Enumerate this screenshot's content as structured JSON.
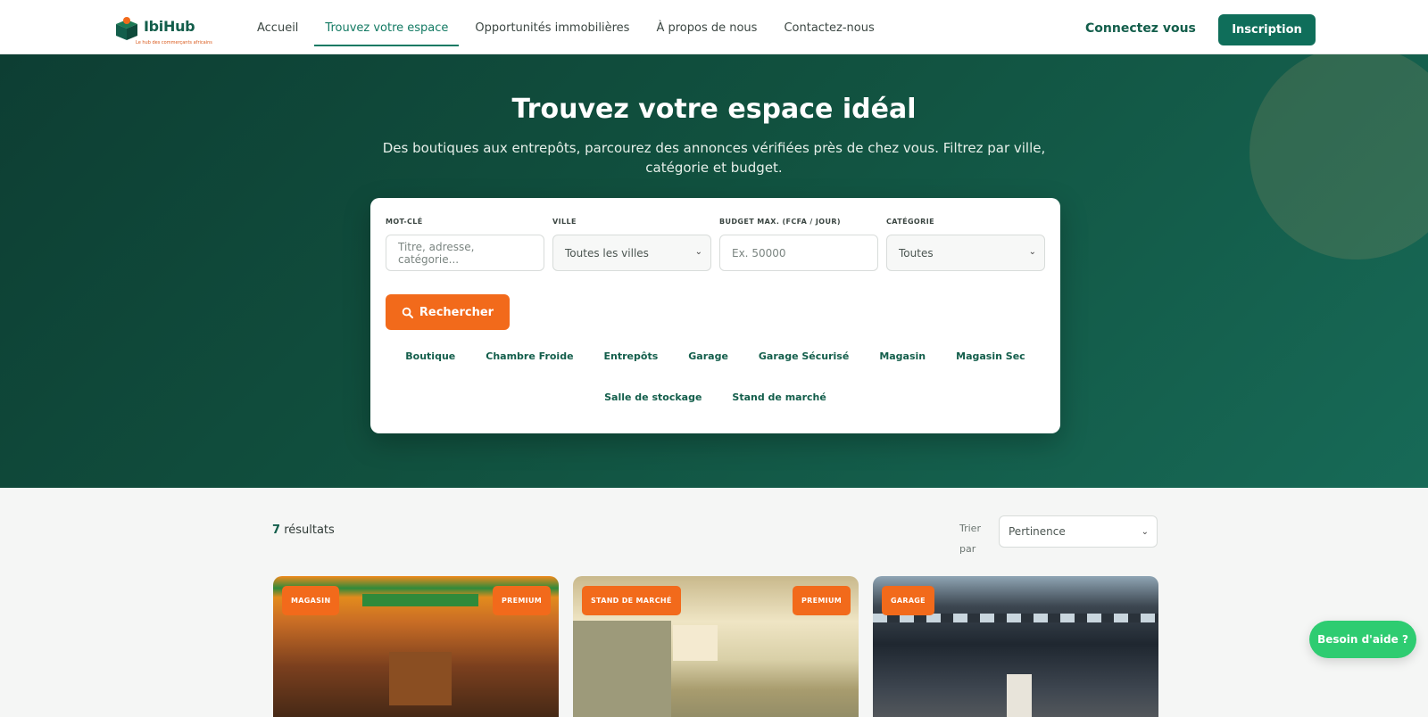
{
  "header": {
    "logo_text": "IbiHub",
    "logo_tagline": "Le hub des commerçants africains",
    "nav": [
      "Accueil",
      "Trouvez votre espace",
      "Opportunités immobilières",
      "À propos de nous",
      "Contactez-nous"
    ],
    "active_nav": "Trouvez votre espace",
    "login_label": "Connectez vous",
    "signup_label": "Inscription"
  },
  "hero": {
    "title": "Trouvez votre espace idéal",
    "subtitle": "Des boutiques aux entrepôts, parcourez des annonces vérifiées près de chez vous. Filtrez par ville, catégorie et budget."
  },
  "search": {
    "keyword": {
      "label": "MOT-CLÉ",
      "placeholder": "Titre, adresse, catégorie..."
    },
    "city": {
      "label": "VILLE",
      "value": "Toutes les villes"
    },
    "budget": {
      "label": "BUDGET MAX. (FCFA / JOUR)",
      "placeholder": "Ex. 50000"
    },
    "category": {
      "label": "CATÉGORIE",
      "value": "Toutes"
    },
    "button_label": "Rechercher",
    "quick_categories": [
      "Boutique",
      "Chambre Froide",
      "Entrepôts",
      "Garage",
      "Garage Sécurisé",
      "Magasin",
      "Magasin Sec",
      "Salle de stockage",
      "Stand de marché"
    ]
  },
  "results": {
    "count": "7",
    "count_suffix": "résultats",
    "sort_label": "Trier par",
    "sort_value": "Pertinence"
  },
  "listings": [
    {
      "category_badge": "MAGASIN",
      "premium_badge": "PREMIUM"
    },
    {
      "category_badge": "STAND DE MARCHÉ",
      "premium_badge": "PREMIUM"
    },
    {
      "category_badge": "GARAGE",
      "premium_badge": ""
    }
  ],
  "help_label": "Besoin d'aide ?",
  "colors": {
    "primary": "#0f6e5a",
    "accent": "#f26a1b",
    "help": "#2ecc71"
  }
}
